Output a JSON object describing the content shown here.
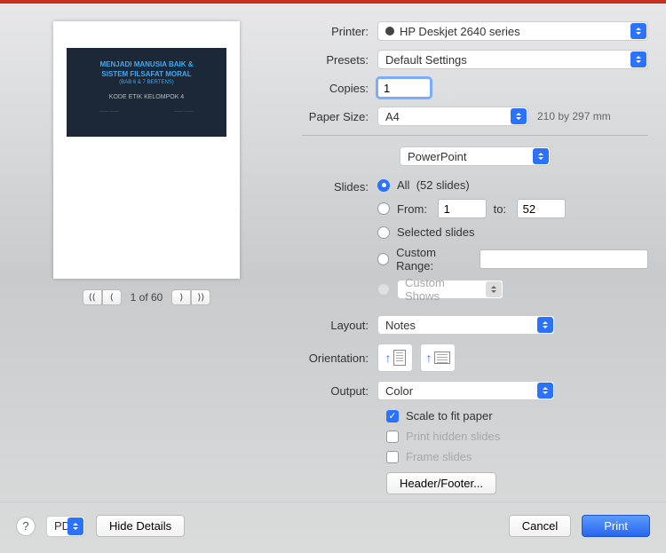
{
  "printer": {
    "label": "Printer:",
    "value": "HP Deskjet 2640 series"
  },
  "presets": {
    "label": "Presets:",
    "value": "Default Settings"
  },
  "copies": {
    "label": "Copies:",
    "value": "1"
  },
  "paper": {
    "label": "Paper Size:",
    "value": "A4",
    "hint": "210 by 297 mm"
  },
  "app_section": "PowerPoint",
  "slides": {
    "label": "Slides:",
    "all_label": "All",
    "all_count": "(52 slides)",
    "from_label": "From:",
    "from_value": "1",
    "to_label": "to:",
    "to_value": "52",
    "selected_label": "Selected slides",
    "custom_range_label": "Custom Range:",
    "custom_shows_label": "Custom Shows"
  },
  "layout": {
    "label": "Layout:",
    "value": "Notes"
  },
  "orientation": {
    "label": "Orientation:"
  },
  "output": {
    "label": "Output:",
    "value": "Color"
  },
  "options": {
    "scale": "Scale to fit paper",
    "hidden": "Print hidden slides",
    "frame": "Frame slides"
  },
  "header_footer_btn": "Header/Footer...",
  "preview": {
    "page_label": "1 of 60",
    "slide_t1": "MENJADI MANUSIA BAIK &",
    "slide_t2": "SISTEM FILSAFAT MORAL",
    "slide_t3": "(BAB 6 & 7 BERTENS)",
    "slide_t4": "KODE ETIK KELOMPOK 4"
  },
  "footer": {
    "pdf": "PDF",
    "hide_details": "Hide Details",
    "cancel": "Cancel",
    "print": "Print"
  }
}
